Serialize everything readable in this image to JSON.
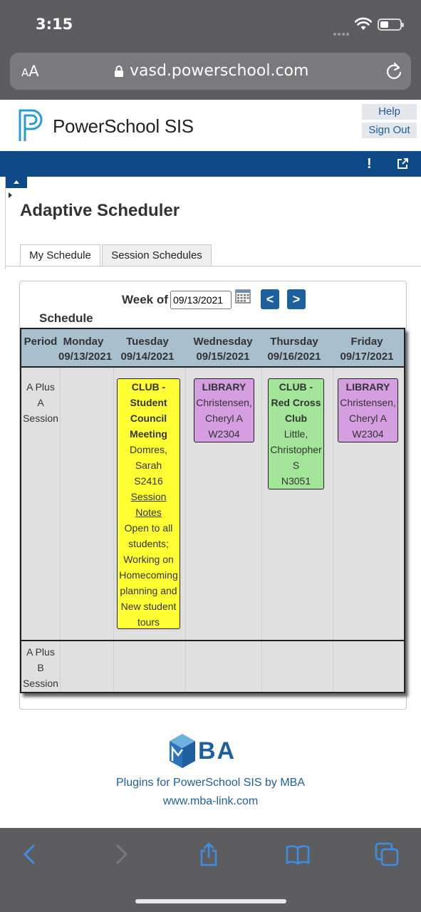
{
  "status_bar": {
    "time": "3:15"
  },
  "browser": {
    "aa_small": "A",
    "aa_big": "A",
    "url": "vasd.powerschool.com"
  },
  "header": {
    "title": "PowerSchool SIS",
    "help": "Help",
    "sign_out": "Sign Out"
  },
  "nav": {
    "alert": "!"
  },
  "page": {
    "title": "Adaptive Scheduler"
  },
  "tabs": [
    {
      "label": "My Schedule"
    },
    {
      "label": "Session Schedules"
    }
  ],
  "schedule": {
    "week_label": "Week of",
    "week_value": "09/13/2021",
    "prev": "<",
    "next": ">",
    "heading": "Schedule",
    "columns": [
      {
        "name": "Period",
        "date": ""
      },
      {
        "name": "Monday",
        "date": "09/13/2021"
      },
      {
        "name": "Tuesday",
        "date": "09/14/2021"
      },
      {
        "name": "Wednesday",
        "date": "09/15/2021"
      },
      {
        "name": "Thursday",
        "date": "09/16/2021"
      },
      {
        "name": "Friday",
        "date": "09/17/2021"
      }
    ],
    "periods": [
      {
        "l1": "A Plus",
        "l2": "A",
        "l3": "Session"
      },
      {
        "l1": "A Plus",
        "l2": "B",
        "l3": "Session"
      }
    ],
    "blocks": {
      "tuesday": {
        "title_lines": [
          "CLUB -",
          "Student",
          "Council",
          "Meeting"
        ],
        "teacher_lines": [
          "Domres,",
          "Sarah"
        ],
        "room": "S2416",
        "link_lines": [
          "Session",
          "Notes"
        ],
        "note_lines": [
          "Open to all",
          "students;",
          "Working on",
          "Homecoming",
          "planning and",
          "New student",
          "tours"
        ]
      },
      "wednesday": {
        "title": "LIBRARY",
        "teacher_lines": [
          "Christensen,",
          "Cheryl A"
        ],
        "room": "W2304"
      },
      "thursday": {
        "title_lines": [
          "CLUB -",
          "Red Cross",
          "Club"
        ],
        "teacher_lines": [
          "Little,",
          "Christopher",
          "S"
        ],
        "room": "N3051"
      },
      "friday": {
        "title": "LIBRARY",
        "teacher_lines": [
          "Christensen,",
          "Cheryl A"
        ],
        "room": "W2304"
      }
    }
  },
  "footer": {
    "brand": "BA",
    "line1": "Plugins for PowerSchool SIS by MBA",
    "line2": "www.mba-link.com"
  }
}
